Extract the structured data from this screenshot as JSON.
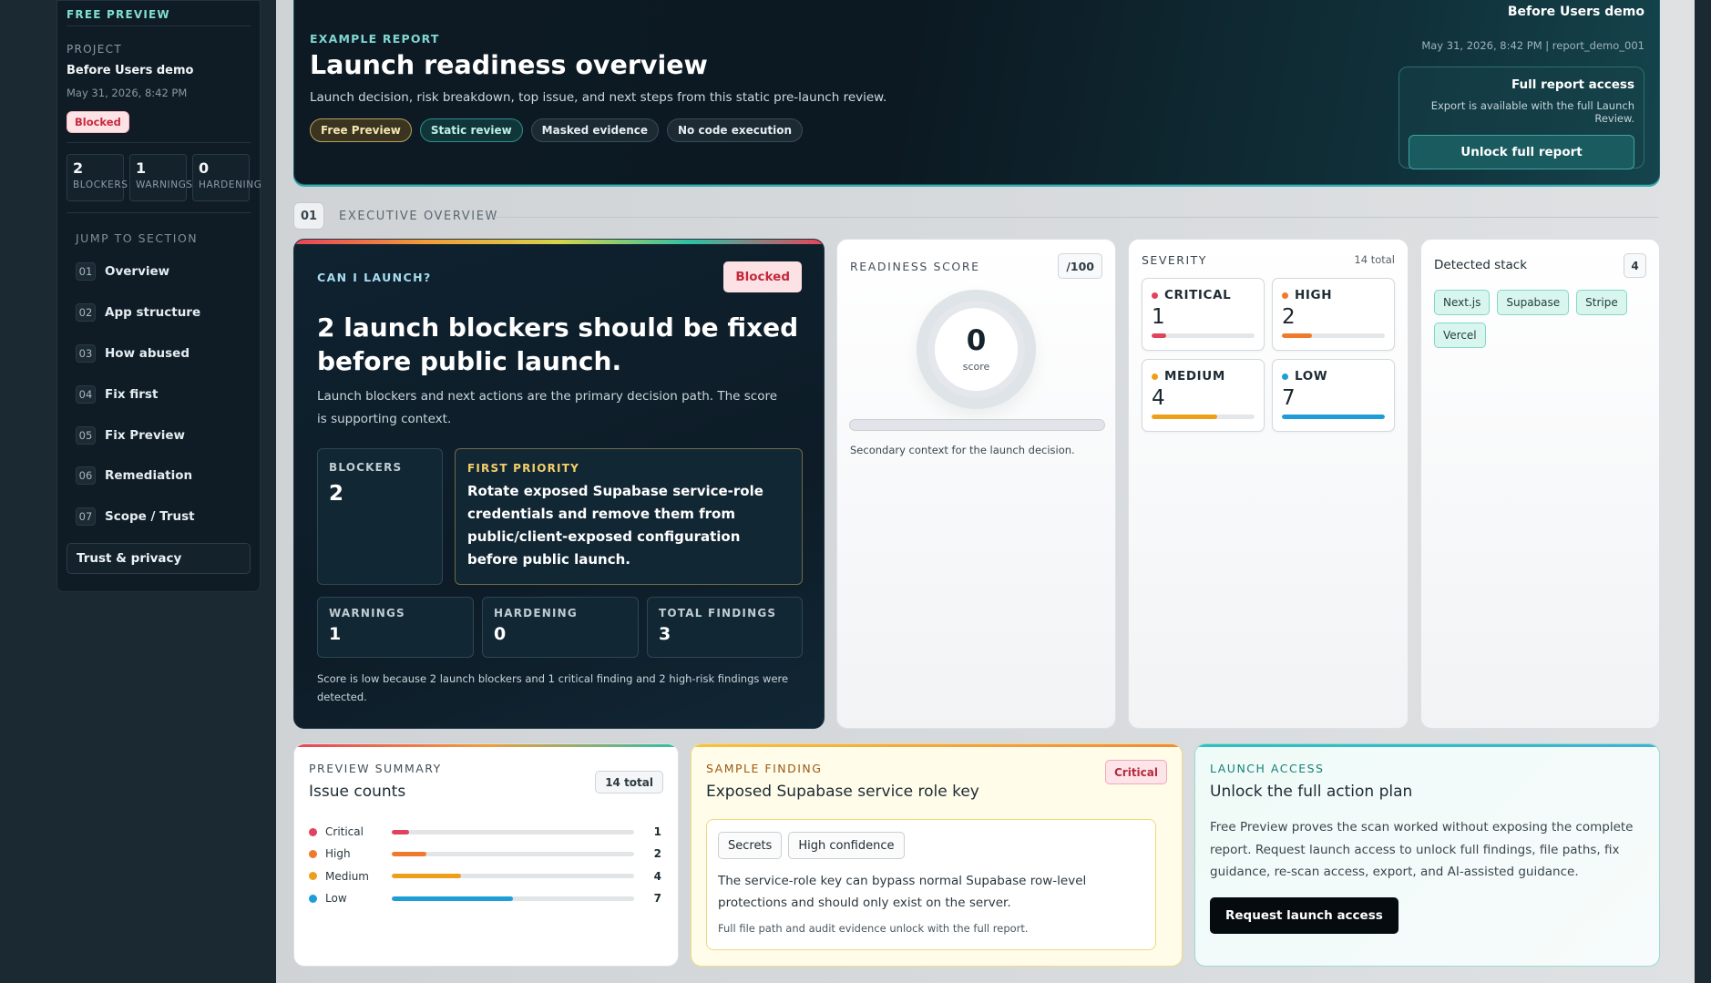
{
  "sidebar": {
    "top_label": "FREE PREVIEW",
    "project_label": "PROJECT",
    "project_name": "Before Users demo",
    "date": "May 31, 2026, 8:42 PM",
    "status_badge": "Blocked",
    "counts": [
      {
        "value": "2",
        "label": "BLOCKERS"
      },
      {
        "value": "1",
        "label": "WARNINGS"
      },
      {
        "value": "0",
        "label": "HARDENING"
      }
    ],
    "jump_label": "JUMP TO SECTION",
    "nav": [
      {
        "num": "01",
        "label": "Overview"
      },
      {
        "num": "02",
        "label": "App structure"
      },
      {
        "num": "03",
        "label": "How abused"
      },
      {
        "num": "04",
        "label": "Fix first"
      },
      {
        "num": "05",
        "label": "Fix Preview"
      },
      {
        "num": "06",
        "label": "Remediation"
      },
      {
        "num": "07",
        "label": "Scope / Trust"
      }
    ],
    "trust_label": "Trust & privacy"
  },
  "header": {
    "eyebrow": "EXAMPLE REPORT",
    "title": "Launch readiness overview",
    "subtitle": "Launch decision, risk breakdown, top issue, and next steps from this static pre-launch review.",
    "pills": [
      "Free Preview",
      "Static review",
      "Masked evidence",
      "No code execution"
    ],
    "right_name": "Before Users demo",
    "right_meta": "May 31, 2026, 8:42 PM | report_demo_001",
    "access_title": "Full report access",
    "access_sub": "Export is available with the full Launch Review.",
    "access_button": "Unlock full report"
  },
  "section": {
    "num": "01",
    "name": "EXECUTIVE OVERVIEW"
  },
  "launch": {
    "eyebrow": "CAN I LAUNCH?",
    "badge": "Blocked",
    "title": "2 launch blockers should be fixed before public launch.",
    "subtitle": "Launch blockers and next actions are the primary decision path. The score is supporting context.",
    "blockers_label": "BLOCKERS",
    "blockers_value": "2",
    "priority_label": "FIRST PRIORITY",
    "priority_text": "Rotate exposed Supabase service-role credentials and remove them from public/client-exposed configuration before public launch.",
    "stats": [
      {
        "label": "WARNINGS",
        "value": "1"
      },
      {
        "label": "HARDENING",
        "value": "0"
      },
      {
        "label": "TOTAL FINDINGS",
        "value": "3"
      }
    ],
    "footer": "Score is low because 2 launch blockers and 1 critical finding and 2 high-risk findings were detected."
  },
  "readiness": {
    "label": "READINESS SCORE",
    "max": "/100",
    "score": "0",
    "score_label": "score",
    "progress": 0,
    "caption": "Secondary context for the launch decision."
  },
  "severity": {
    "label": "SEVERITY",
    "total": "14 total",
    "items": [
      {
        "name": "CRITICAL",
        "value": "1",
        "fraction": 0.14,
        "color": "#e0435a"
      },
      {
        "name": "HIGH",
        "value": "2",
        "fraction": 0.29,
        "color": "#ef7a2c"
      },
      {
        "name": "MEDIUM",
        "value": "4",
        "fraction": 0.64,
        "color": "#ee9f1a"
      },
      {
        "name": "LOW",
        "value": "7",
        "fraction": 1.0,
        "color": "#1f9dd8"
      }
    ]
  },
  "stack": {
    "label": "Detected stack",
    "count": "4",
    "tags": [
      "Next.js",
      "Supabase",
      "Stripe",
      "Vercel"
    ]
  },
  "preview_summary": {
    "eyebrow": "PREVIEW SUMMARY",
    "title": "Issue counts",
    "total": "14 total",
    "rows": [
      {
        "name": "Critical",
        "value": "1",
        "fraction": 0.0714,
        "color": "#e0435a"
      },
      {
        "name": "High",
        "value": "2",
        "fraction": 0.1428,
        "color": "#ef7a2c"
      },
      {
        "name": "Medium",
        "value": "4",
        "fraction": 0.2857,
        "color": "#ee9f1a"
      },
      {
        "name": "Low",
        "value": "7",
        "fraction": 0.5,
        "color": "#1f9dd8"
      }
    ]
  },
  "sample_finding": {
    "eyebrow": "SAMPLE FINDING",
    "title": "Exposed Supabase service role key",
    "badge": "Critical",
    "tags": [
      "Secrets",
      "High confidence"
    ],
    "description": "The service-role key can bypass normal Supabase row-level protections and should only exist on the server.",
    "footer": "Full file path and audit evidence unlock with the full report."
  },
  "launch_access": {
    "eyebrow": "LAUNCH ACCESS",
    "title": "Unlock the full action plan",
    "description": "Free Preview proves the scan worked without exposing the complete report. Request launch access to unlock full findings, file paths, fix guidance, re-scan access, export, and AI-assisted guidance.",
    "button": "Request launch access"
  }
}
